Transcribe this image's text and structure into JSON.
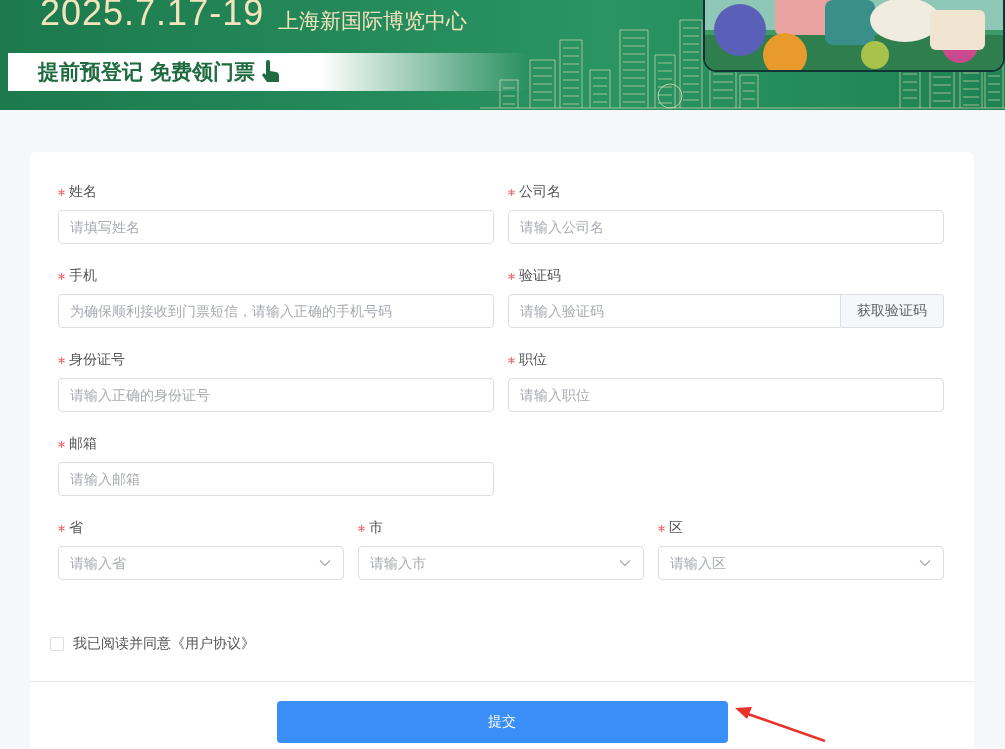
{
  "banner": {
    "date": "2025.7.17-19",
    "venue": "上海新国际博览中心",
    "cta": "提前预登记 免费领门票"
  },
  "form": {
    "fields": [
      {
        "kind": "text",
        "label": "姓名",
        "required": true,
        "placeholder": "请填写姓名"
      },
      {
        "kind": "text",
        "label": "公司名",
        "required": true,
        "placeholder": "请输入公司名"
      },
      {
        "kind": "text",
        "label": "手机",
        "required": true,
        "placeholder": "为确保顺利接收到门票短信，请输入正确的手机号码"
      },
      {
        "kind": "code",
        "label": "验证码",
        "required": true,
        "placeholder": "请输入验证码",
        "button": "获取验证码"
      },
      {
        "kind": "text",
        "label": "身份证号",
        "required": true,
        "placeholder": "请输入正确的身份证号"
      },
      {
        "kind": "text",
        "label": "职位",
        "required": true,
        "placeholder": "请输入职位"
      },
      {
        "kind": "text",
        "label": "邮箱",
        "required": true,
        "placeholder": "请输入邮箱"
      }
    ],
    "address": [
      {
        "label": "省",
        "required": true,
        "placeholder": "请输入省"
      },
      {
        "label": "市",
        "required": true,
        "placeholder": "请输入市"
      },
      {
        "label": "区",
        "required": true,
        "placeholder": "请输入区"
      }
    ],
    "agreement": {
      "label": "我已阅读并同意《用户协议》",
      "checked": false
    },
    "submit": "提交"
  }
}
